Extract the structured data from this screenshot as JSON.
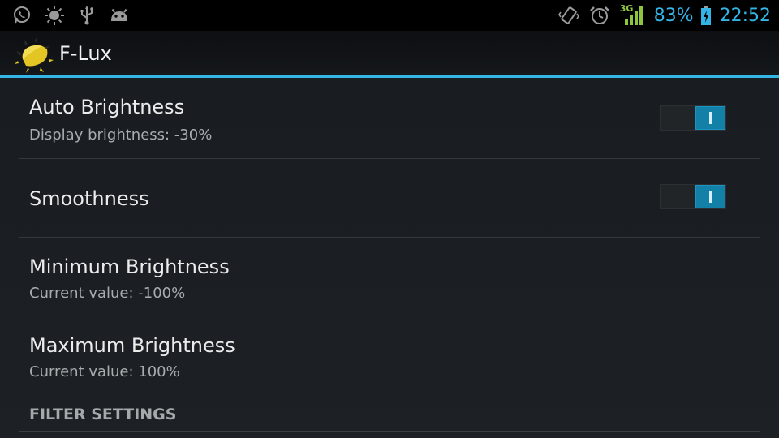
{
  "status_bar": {
    "notification_icons": [
      "whatsapp-icon",
      "sun-icon",
      "usb-icon",
      "android-icon"
    ],
    "system_icons": [
      "vibrate-icon",
      "alarm-icon",
      "signal-icon"
    ],
    "network_type": "3G",
    "battery_percent": "83%",
    "time": "22:52",
    "accent_color": "#33b5e5",
    "signal_color": "#8ec63f"
  },
  "action_bar": {
    "app_icon": "f-lux-sun-icon",
    "title": "F-Lux"
  },
  "preferences": [
    {
      "title": "Auto Brightness",
      "summary": "Display brightness: -30%",
      "has_toggle": true,
      "toggle_on": true
    },
    {
      "title": "Smoothness",
      "summary": "",
      "has_toggle": true,
      "toggle_on": true
    },
    {
      "title": "Minimum Brightness",
      "summary": "Current value: -100%",
      "has_toggle": false
    },
    {
      "title": "Maximum Brightness",
      "summary": "Current value: 100%",
      "has_toggle": false
    }
  ],
  "category": {
    "label": "FILTER SETTINGS"
  }
}
